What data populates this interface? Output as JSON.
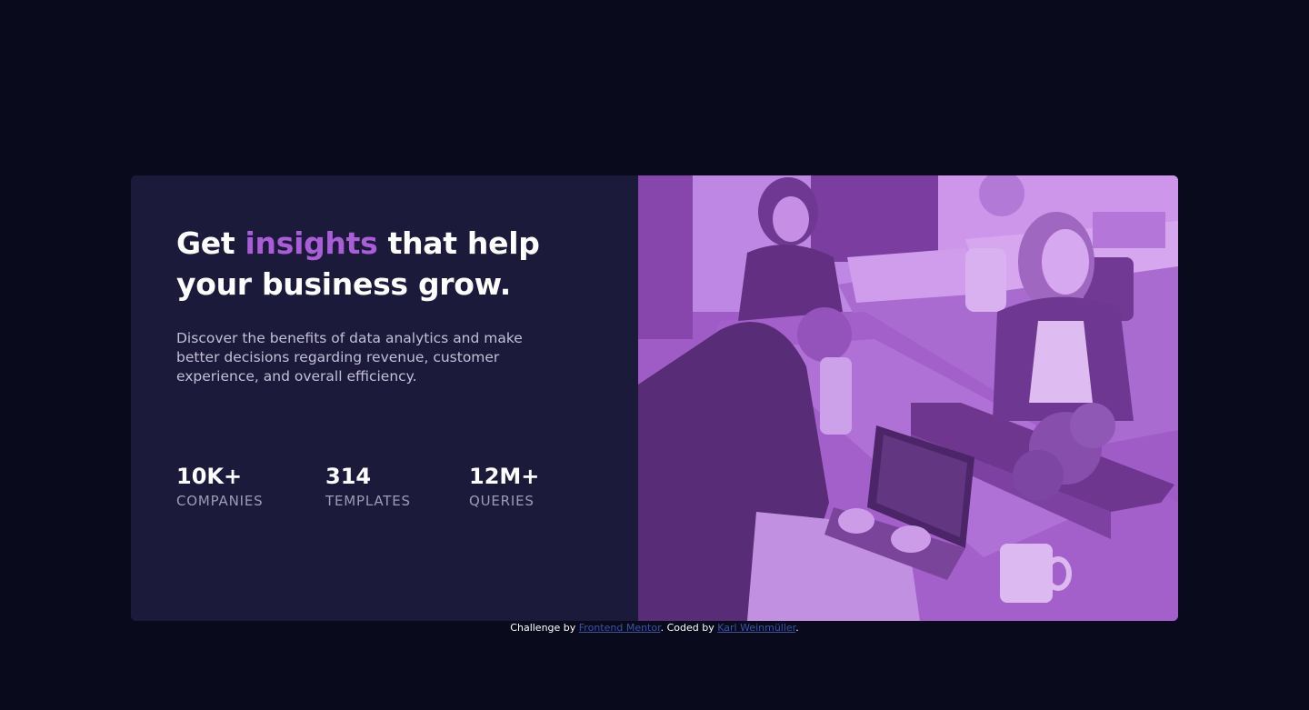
{
  "hero": {
    "headline_before": "Get ",
    "headline_accent": "insights",
    "headline_after": " that help your business grow.",
    "description": "Discover the benefits of data analytics and make better decisions regarding revenue, customer experience, and overall efficiency.",
    "accent_color": "#a95ed8"
  },
  "stats": [
    {
      "value": "10K+",
      "label": "COMPANIES"
    },
    {
      "value": "314",
      "label": "TEMPLATES"
    },
    {
      "value": "12M+",
      "label": "QUERIES"
    }
  ],
  "image": {
    "icon": "office-photo-image",
    "tint_color": "#aa5cdb"
  },
  "attribution": {
    "prefix": "Challenge by ",
    "link1": "Frontend Mentor",
    "middle": ". Coded by ",
    "link2": "Karl Weinmüller",
    "suffix": "."
  },
  "colors": {
    "background": "#090b1d",
    "card": "#1c1a3a",
    "link": "#3e52a3"
  }
}
